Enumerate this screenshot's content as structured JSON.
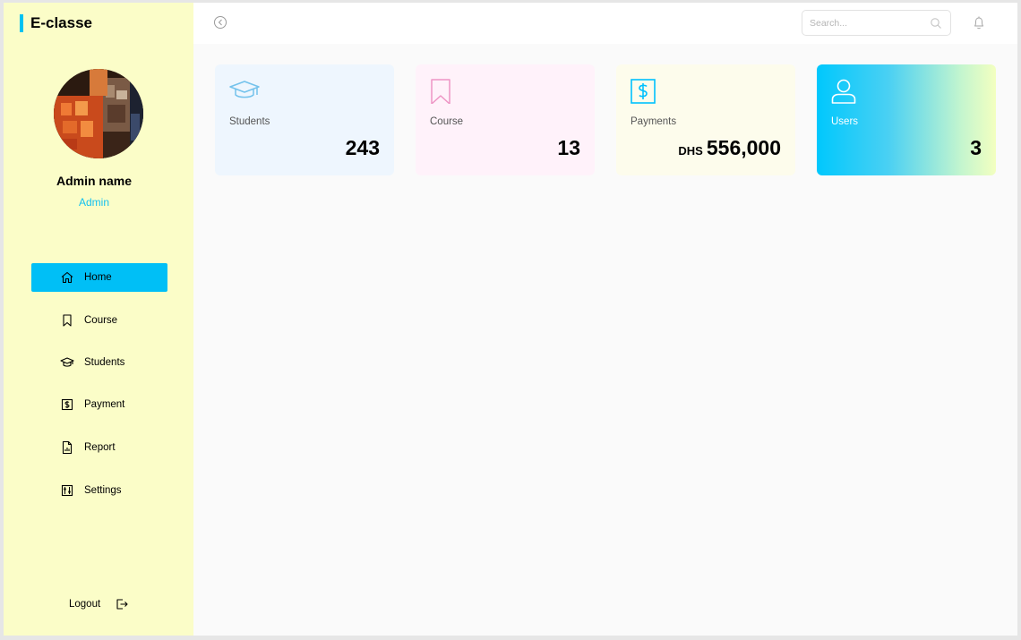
{
  "brand": {
    "name": "E-classe"
  },
  "profile": {
    "name": "Admin name",
    "role": "Admin"
  },
  "nav": {
    "items": [
      {
        "label": "Home",
        "icon": "home-icon",
        "active": true
      },
      {
        "label": "Course",
        "icon": "bookmark-icon"
      },
      {
        "label": "Students",
        "icon": "graduation-cap-icon"
      },
      {
        "label": "Payment",
        "icon": "dollar-icon"
      },
      {
        "label": "Report",
        "icon": "report-icon"
      },
      {
        "label": "Settings",
        "icon": "settings-sliders-icon"
      }
    ],
    "logout_label": "Logout"
  },
  "topbar": {
    "search_placeholder": "Search..."
  },
  "cards": [
    {
      "label": "Students",
      "value": "243",
      "icon": "graduation-cap-icon",
      "accent": "#74c2ec"
    },
    {
      "label": "Course",
      "value": "13",
      "icon": "bookmark-icon",
      "accent": "#ee95c5"
    },
    {
      "label": "Payments",
      "prefix": "DHS",
      "value": "556,000",
      "icon": "dollar-square-icon",
      "accent": "#00c1fe"
    },
    {
      "label": "Users",
      "value": "3",
      "icon": "user-icon",
      "accent": "#ffffff"
    }
  ],
  "colors": {
    "sidebar_bg": "#fbfdc8",
    "accent": "#00bff6",
    "main_bg": "#fafafa"
  }
}
